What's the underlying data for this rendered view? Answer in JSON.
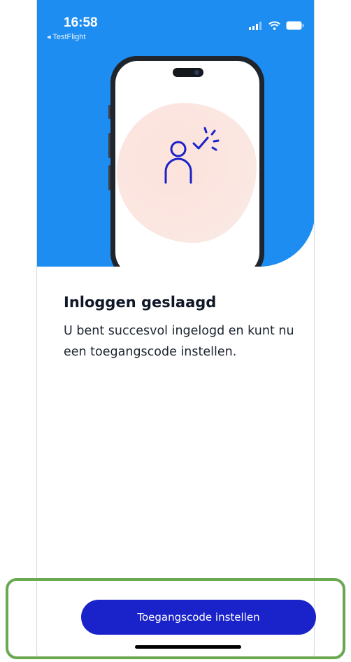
{
  "status_bar": {
    "time": "16:58",
    "back_app": "◂ TestFlight"
  },
  "icons": {
    "signal": "cellular-signal-icon",
    "wifi": "wifi-icon",
    "battery": "battery-icon",
    "user_check": "user-check-icon"
  },
  "colors": {
    "hero_blue": "#1d8df1",
    "button_blue": "#1a22c9",
    "icon_navy": "#1a22c9",
    "highlight_green": "#6aa84f"
  },
  "content": {
    "title": "Inloggen geslaagd",
    "body": "U bent succesvol ingelogd en kunt nu een toegangscode instellen."
  },
  "actions": {
    "primary_label": "Toegangscode instellen"
  }
}
